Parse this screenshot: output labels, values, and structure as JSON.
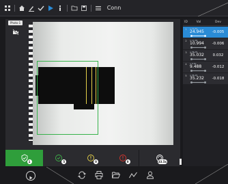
{
  "app": {
    "title": "Conn"
  },
  "toolbar": {
    "icons": [
      "grid-icon",
      "home-icon",
      "edit-icon",
      "check-icon",
      "run-icon",
      "info-icon",
      "folder-icon",
      "save-icon",
      "menu-icon"
    ]
  },
  "camera": {
    "label": "Photo 1",
    "roi_color": "#36b24a",
    "marker_color": "#e7d24a"
  },
  "status_tiles": [
    {
      "name": "pass",
      "icon": "shield-check-icon",
      "count": "1",
      "color": "#2f9e3b"
    },
    {
      "name": "warning",
      "icon": "check-circle-icon",
      "count": "5",
      "color": "#3fb24a"
    },
    {
      "name": "info",
      "icon": "info-circle-icon",
      "count": "0",
      "color": "#e7d24a"
    },
    {
      "name": "fail",
      "icon": "error-circle-icon",
      "count": "0",
      "color": "#d9352f"
    },
    {
      "name": "cycle",
      "icon": "cycle-icon",
      "count": "33.5s",
      "color": "#ffffff"
    }
  ],
  "results": {
    "columns": [
      "ID",
      "Val",
      "Dev"
    ],
    "rows": [
      {
        "id": "1",
        "sub": "x 24.80",
        "value": "24.945",
        "dev": "-0.005",
        "selected": true
      },
      {
        "id": "2",
        "sub": "x 11.00",
        "value": "10.994",
        "dev": "-0.006",
        "selected": false
      },
      {
        "id": "3",
        "sub": "x 35.00",
        "value": "35.032",
        "dev": "0.032",
        "selected": false
      },
      {
        "id": "4",
        "sub": "x 9.50",
        "value": "9.488",
        "dev": "-0.012",
        "selected": false
      },
      {
        "id": "5",
        "sub": "x 35.25",
        "value": "35.232",
        "dev": "-0.018",
        "selected": false
      }
    ]
  },
  "bottom_toolbar": {
    "icons": [
      "play-icon",
      "sync-icon",
      "print-icon",
      "folder-open-icon",
      "trend-icon",
      "user-icon"
    ]
  },
  "colors": {
    "accent": "#2a8bd6",
    "background": "#1a1a1d"
  }
}
